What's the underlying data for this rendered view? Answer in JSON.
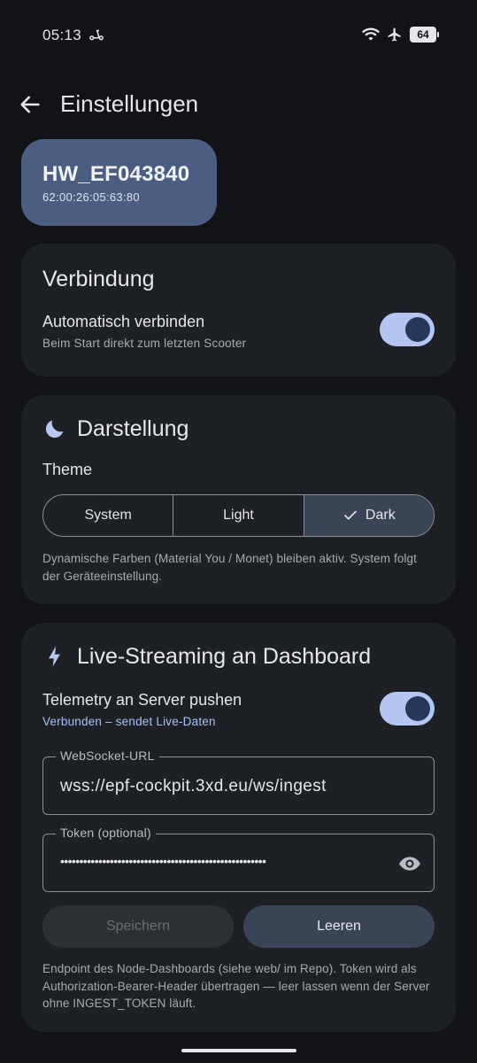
{
  "status_bar": {
    "time": "05:13",
    "battery": "64",
    "icons": [
      "scooter-icon",
      "wifi-icon",
      "airplane-icon",
      "battery-icon"
    ]
  },
  "app_bar": {
    "title": "Einstellungen",
    "back_icon": "arrow-left-icon"
  },
  "device": {
    "name": "HW_EF043840",
    "mac": "62:00:26:05:63:80"
  },
  "connection": {
    "title": "Verbindung",
    "auto_connect_title": "Automatisch verbinden",
    "auto_connect_sub": "Beim Start direkt zum letzten Scooter",
    "auto_connect_on": true
  },
  "appearance": {
    "title": "Darstellung",
    "icon": "moon-icon",
    "theme_label": "Theme",
    "options": [
      "System",
      "Light",
      "Dark"
    ],
    "selected": "Dark",
    "note": "Dynamische Farben (Material You / Monet) bleiben aktiv. System folgt der Geräteeinstellung."
  },
  "streaming": {
    "title": "Live-Streaming an Dashboard",
    "icon": "bolt-icon",
    "push_title": "Telemetry an Server pushen",
    "push_status": "Verbunden – sendet Live-Daten",
    "push_on": true,
    "url_label": "WebSocket-URL",
    "url_value": "wss://epf-cockpit.3xd.eu/ws/ingest",
    "token_label": "Token (optional)",
    "token_masked": "••••••••••••••••••••••••••••••••••••••••••••••••••••••",
    "save_label": "Speichern",
    "clear_label": "Leeren",
    "note": "Endpoint des Node-Dashboards (siehe web/ im Repo). Token wird als Authorization-Bearer-Header übertragen — leer lassen wenn der Server ohne INGEST_TOKEN läuft."
  },
  "colors": {
    "background": "#111316",
    "card": "#1d2024",
    "accent": "#b3c5f0",
    "device_chip": "#4b5d80",
    "link_blue": "#a9c1f7"
  }
}
